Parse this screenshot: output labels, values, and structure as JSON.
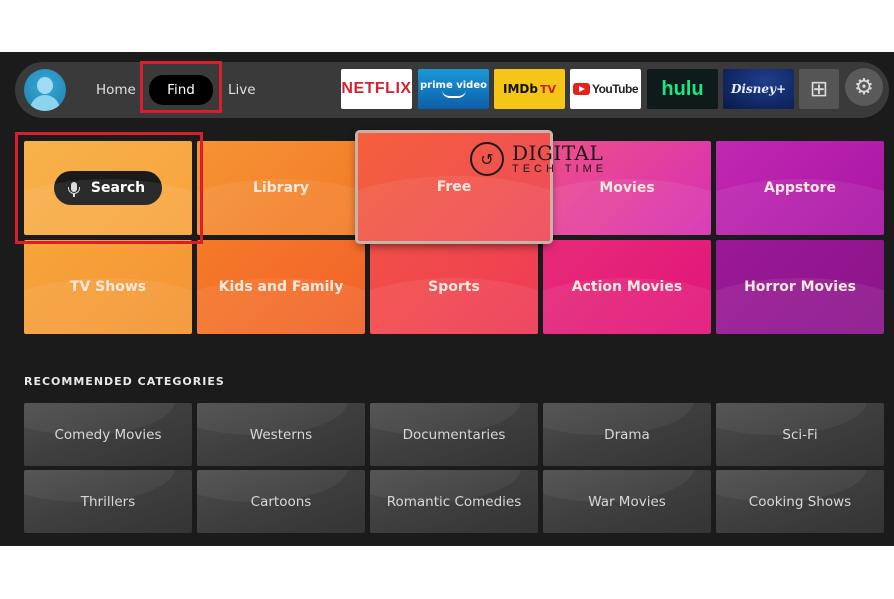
{
  "nav": {
    "items": [
      {
        "label": "Home"
      },
      {
        "label": "Find",
        "selected": true
      },
      {
        "label": "Live"
      }
    ]
  },
  "apps": [
    {
      "label": "NETFLIX"
    },
    {
      "label": "prime video"
    },
    {
      "label": "IMDb",
      "suffix": "TV"
    },
    {
      "label": "YouTube"
    },
    {
      "label": "hulu"
    },
    {
      "label": "Disney+"
    }
  ],
  "icons": {
    "apps_grid": "⊞",
    "settings": "⚙",
    "watermark_logo": "↺"
  },
  "categories": [
    {
      "label": "Search"
    },
    {
      "label": "Library"
    },
    {
      "label": "Free"
    },
    {
      "label": "Movies"
    },
    {
      "label": "Appstore"
    },
    {
      "label": "TV Shows"
    },
    {
      "label": "Kids and Family"
    },
    {
      "label": "Sports"
    },
    {
      "label": "Action Movies"
    },
    {
      "label": "Horror Movies"
    }
  ],
  "recommended": {
    "title": "RECOMMENDED CATEGORIES",
    "items": [
      {
        "label": "Comedy Movies"
      },
      {
        "label": "Westerns"
      },
      {
        "label": "Documentaries"
      },
      {
        "label": "Drama"
      },
      {
        "label": "Sci-Fi"
      },
      {
        "label": "Thrillers"
      },
      {
        "label": "Cartoons"
      },
      {
        "label": "Romantic Comedies"
      },
      {
        "label": "War Movies"
      },
      {
        "label": "Cooking Shows"
      }
    ]
  },
  "watermark": {
    "line1": "DIGITAL",
    "line2": "TECH TIME"
  },
  "colors": {
    "highlight": "#d91f2d",
    "background": "#1b1b1b"
  }
}
